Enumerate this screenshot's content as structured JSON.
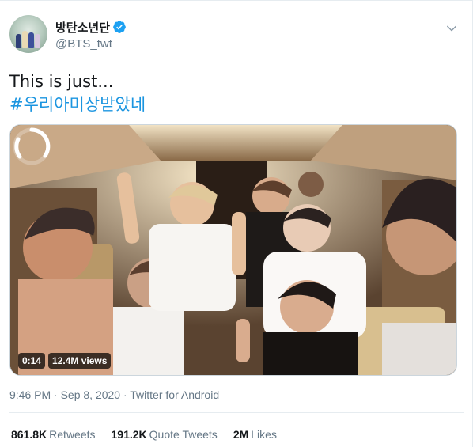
{
  "tweet": {
    "author": {
      "display_name": "방탄소년단",
      "handle": "@BTS_twt",
      "verified_icon": "verified-badge-icon",
      "avatar_icon": "profile-avatar"
    },
    "menu_icon": "chevron-down-icon",
    "text_line": "This is just...",
    "hashtag": "#우리아미상받았네",
    "media": {
      "duration": "0:14",
      "views": "12.4M views",
      "loading_icon": "loading-spinner-icon"
    },
    "meta": "9:46 PM · Sep 8, 2020 · Twitter for Android",
    "stats": [
      {
        "count": "861.8K",
        "label": "Retweets"
      },
      {
        "count": "191.2K",
        "label": "Quote Tweets"
      },
      {
        "count": "2M",
        "label": "Likes"
      }
    ]
  },
  "colors": {
    "link": "#1b95e0",
    "secondary_text": "#657786",
    "verified": "#1da1f2"
  }
}
